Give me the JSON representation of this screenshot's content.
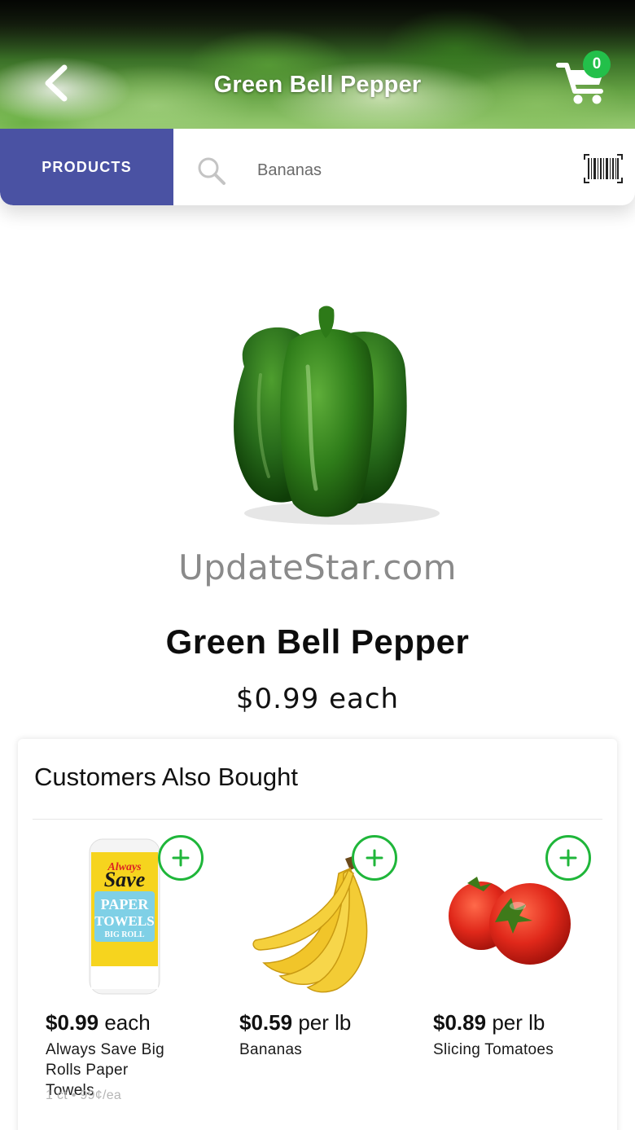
{
  "header": {
    "title": "Green Bell Pepper",
    "cart_count": "0",
    "colors": {
      "badge": "#23c04a"
    }
  },
  "search": {
    "tab_label": "PRODUCTS",
    "placeholder": "Bananas",
    "icons": [
      "search-icon",
      "barcode-icon"
    ],
    "tab_color": "#4a52a3"
  },
  "product": {
    "name": "Green Bell Pepper",
    "price": "$0.99 each",
    "watermark": "UpdateStar.com"
  },
  "also_bought": {
    "title": "Customers Also Bought",
    "add_color": "#1fb63a",
    "items": [
      {
        "price": "$0.99",
        "unit": "each",
        "name_line1": "Always Save Big",
        "name_line2": "Rolls Paper Towels",
        "meta": "1 ct • 99¢/ea"
      },
      {
        "price": "$0.59",
        "unit": "per lb",
        "name_line1": "Bananas"
      },
      {
        "price": "$0.89",
        "unit": "per lb",
        "name_line1": "Slicing Tomatoes"
      }
    ]
  }
}
